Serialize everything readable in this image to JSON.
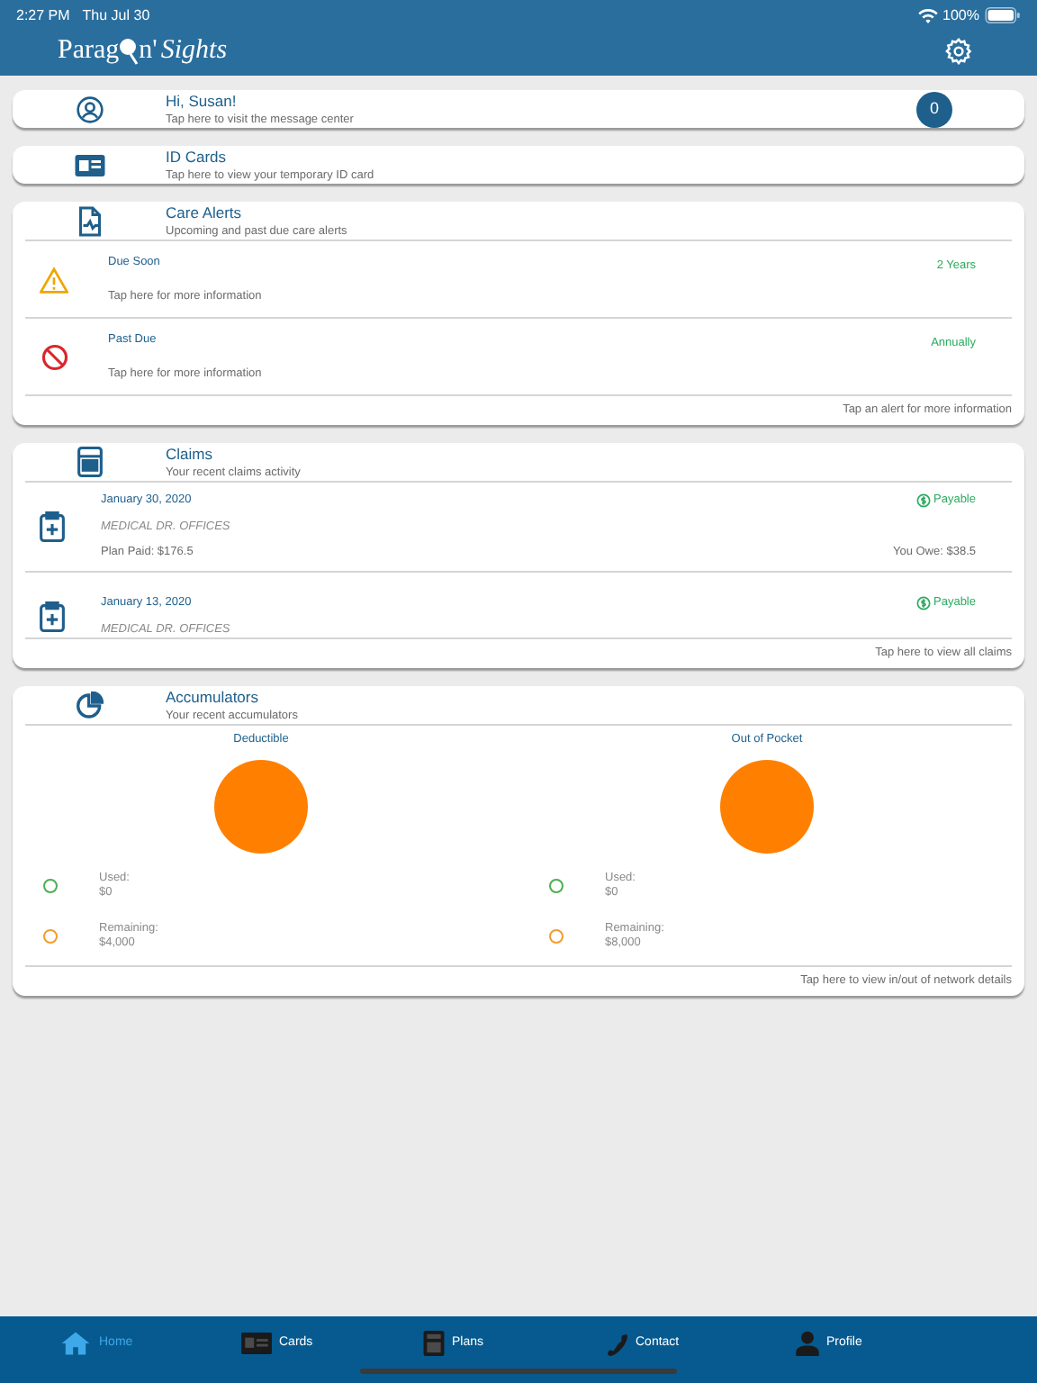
{
  "status_bar": {
    "time": "2:27 PM",
    "date": "Thu Jul 30",
    "battery": "100%"
  },
  "header": {
    "logo_left": "Parag",
    "logo_mid": "n'",
    "logo_right": "Sights"
  },
  "greeting": {
    "title": "Hi, Susan!",
    "subtitle": "Tap here to visit the message center",
    "badge": "0"
  },
  "id_cards": {
    "title": "ID Cards",
    "subtitle": "Tap here to view your temporary ID card"
  },
  "care_alerts": {
    "title": "Care Alerts",
    "subtitle": "Upcoming and past due care alerts",
    "footer": "Tap an alert for more information",
    "items": [
      {
        "kind": "due_soon",
        "title": "Due Soon",
        "detail": "Tap here for more information",
        "frequency": "2 Years"
      },
      {
        "kind": "past_due",
        "title": "Past Due",
        "detail": "Tap here for more information",
        "frequency": "Annually"
      }
    ]
  },
  "claims": {
    "title": "Claims",
    "subtitle": "Your recent claims activity",
    "footer": "Tap here to view all claims",
    "items": [
      {
        "date": "January 30, 2020",
        "provider": "MEDICAL DR. OFFICES",
        "status": "Payable",
        "plan_paid": "Plan Paid: $176.5",
        "you_owe": "You Owe: $38.5"
      },
      {
        "date": "January 13, 2020",
        "provider": "MEDICAL DR. OFFICES",
        "status": "Payable"
      }
    ]
  },
  "accumulators": {
    "title": "Accumulators",
    "subtitle": "Your recent accumulators",
    "footer": "Tap here to view in/out of network details",
    "panels": [
      {
        "title": "Deductible",
        "legend": [
          {
            "label": "Used:",
            "value": "$0",
            "color": "#4caf50"
          },
          {
            "label": "Remaining:",
            "value": "$4,000",
            "color": "#f39c2b"
          }
        ]
      },
      {
        "title": "Out of Pocket",
        "legend": [
          {
            "label": "Used:",
            "value": "$0",
            "color": "#4caf50"
          },
          {
            "label": "Remaining:",
            "value": "$8,000",
            "color": "#f39c2b"
          }
        ]
      }
    ]
  },
  "tabs": [
    {
      "kind": "home",
      "label": "Home",
      "selected": true
    },
    {
      "kind": "cards",
      "label": "Cards",
      "selected": false
    },
    {
      "kind": "plans",
      "label": "Plans",
      "selected": false
    },
    {
      "kind": "contact",
      "label": "Contact",
      "selected": false
    },
    {
      "kind": "profile",
      "label": "Profile",
      "selected": false
    }
  ]
}
